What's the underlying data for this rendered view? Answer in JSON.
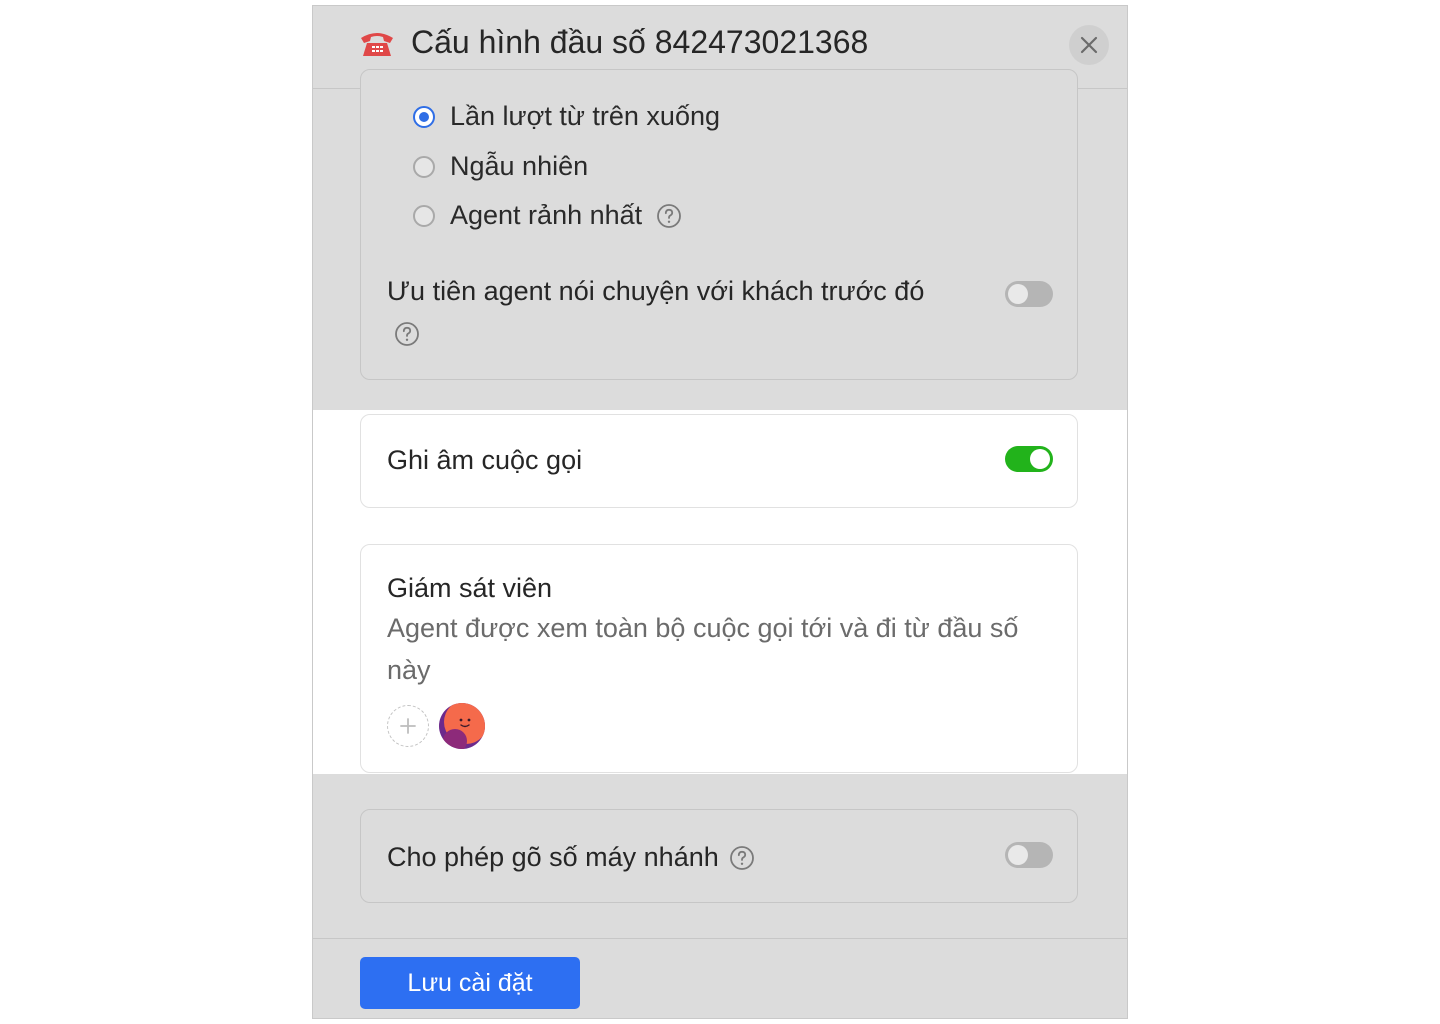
{
  "dialog": {
    "title": "Cấu hình đầu số 842473021368",
    "icon": "phone-icon",
    "close_icon": "close-icon"
  },
  "distribution": {
    "options": [
      {
        "label": "Lần lượt từ trên xuống",
        "checked": true
      },
      {
        "label": "Ngẫu nhiên",
        "checked": false
      },
      {
        "label": "Agent rảnh nhất",
        "checked": false,
        "help": true
      }
    ],
    "prioritize_label": "Ưu tiên agent nói chuyện với khách trước đó",
    "prioritize_enabled": false
  },
  "recording": {
    "label": "Ghi âm cuộc gọi",
    "enabled": true
  },
  "supervisor": {
    "title": "Giám sát viên",
    "description": "Agent được xem toàn bộ cuộc gọi tới và đi từ đầu số này",
    "add_icon": "plus-icon",
    "avatar": "avatar"
  },
  "extension": {
    "label": "Cho phép gõ số máy nhánh",
    "enabled": false
  },
  "footer": {
    "save_label": "Lưu cài đặt"
  },
  "colors": {
    "primary": "#2d6ff2",
    "toggle_on": "#22b31b",
    "overlay": "#dcdcdc",
    "icon_red": "#e04848"
  }
}
